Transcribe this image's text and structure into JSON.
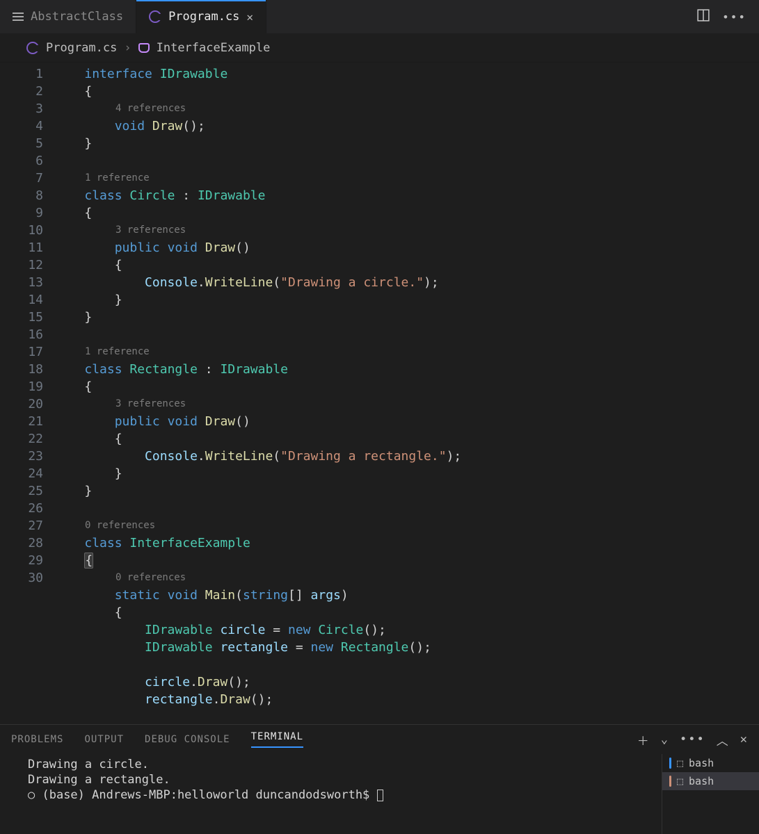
{
  "tabs": {
    "inactive": "AbstractClass",
    "active": "Program.cs"
  },
  "breadcrumb": {
    "file": "Program.cs",
    "symbol": "InterfaceExample"
  },
  "gutter_start": 1,
  "gutter_end": 30,
  "codelens": {
    "idrawable": "4 references",
    "circle_class": "1 reference",
    "circle_draw": "3 references",
    "rect_class": "1 reference",
    "rect_draw": "3 references",
    "iface_class": "0 references",
    "main": "0 references"
  },
  "code": {
    "l1a": "interface",
    "l1b": "IDrawable",
    "l2": "{",
    "l3a": "void",
    "l3b": "Draw",
    "l3c": "();",
    "l4": "}",
    "l6a": "class",
    "l6b": "Circle",
    "l6c": " : ",
    "l6d": "IDrawable",
    "l7": "{",
    "l8a": "public",
    "l8b": "void",
    "l8c": "Draw",
    "l8d": "()",
    "l9": "{",
    "l10a": "Console",
    "l10b": ".",
    "l10c": "WriteLine",
    "l10d": "(",
    "l10e": "\"Drawing a circle.\"",
    "l10f": ");",
    "l11": "}",
    "l12": "}",
    "l14a": "class",
    "l14b": "Rectangle",
    "l14c": " : ",
    "l14d": "IDrawable",
    "l15": "{",
    "l16a": "public",
    "l16b": "void",
    "l16c": "Draw",
    "l16d": "()",
    "l17": "{",
    "l18a": "Console",
    "l18b": ".",
    "l18c": "WriteLine",
    "l18d": "(",
    "l18e": "\"Drawing a rectangle.\"",
    "l18f": ");",
    "l19": "}",
    "l20": "}",
    "l22a": "class",
    "l22b": "InterfaceExample",
    "l23": "{",
    "l24a": "static",
    "l24b": "void",
    "l24c": "Main",
    "l24d": "(",
    "l24e": "string",
    "l24f": "[] ",
    "l24g": "args",
    "l24h": ")",
    "l25": "{",
    "l26a": "IDrawable",
    "l26b": "circle",
    "l26c": " = ",
    "l26d": "new",
    "l26e": "Circle",
    "l26f": "();",
    "l27a": "IDrawable",
    "l27b": "rectangle",
    "l27c": " = ",
    "l27d": "new",
    "l27e": "Rectangle",
    "l27f": "();",
    "l29a": "circle",
    "l29b": ".",
    "l29c": "Draw",
    "l29d": "();",
    "l30a": "rectangle",
    "l30b": ".",
    "l30c": "Draw",
    "l30d": "();"
  },
  "panel": {
    "tabs": {
      "problems": "PROBLEMS",
      "output": "OUTPUT",
      "debug": "DEBUG CONSOLE",
      "terminal": "TERMINAL"
    },
    "output_lines": {
      "o1": "Drawing a circle.",
      "o2": "Drawing a rectangle.",
      "prompt": "(base) Andrews-MBP:helloworld duncandodsworth$ "
    },
    "side": {
      "bash1": "bash",
      "bash2": "bash"
    }
  }
}
